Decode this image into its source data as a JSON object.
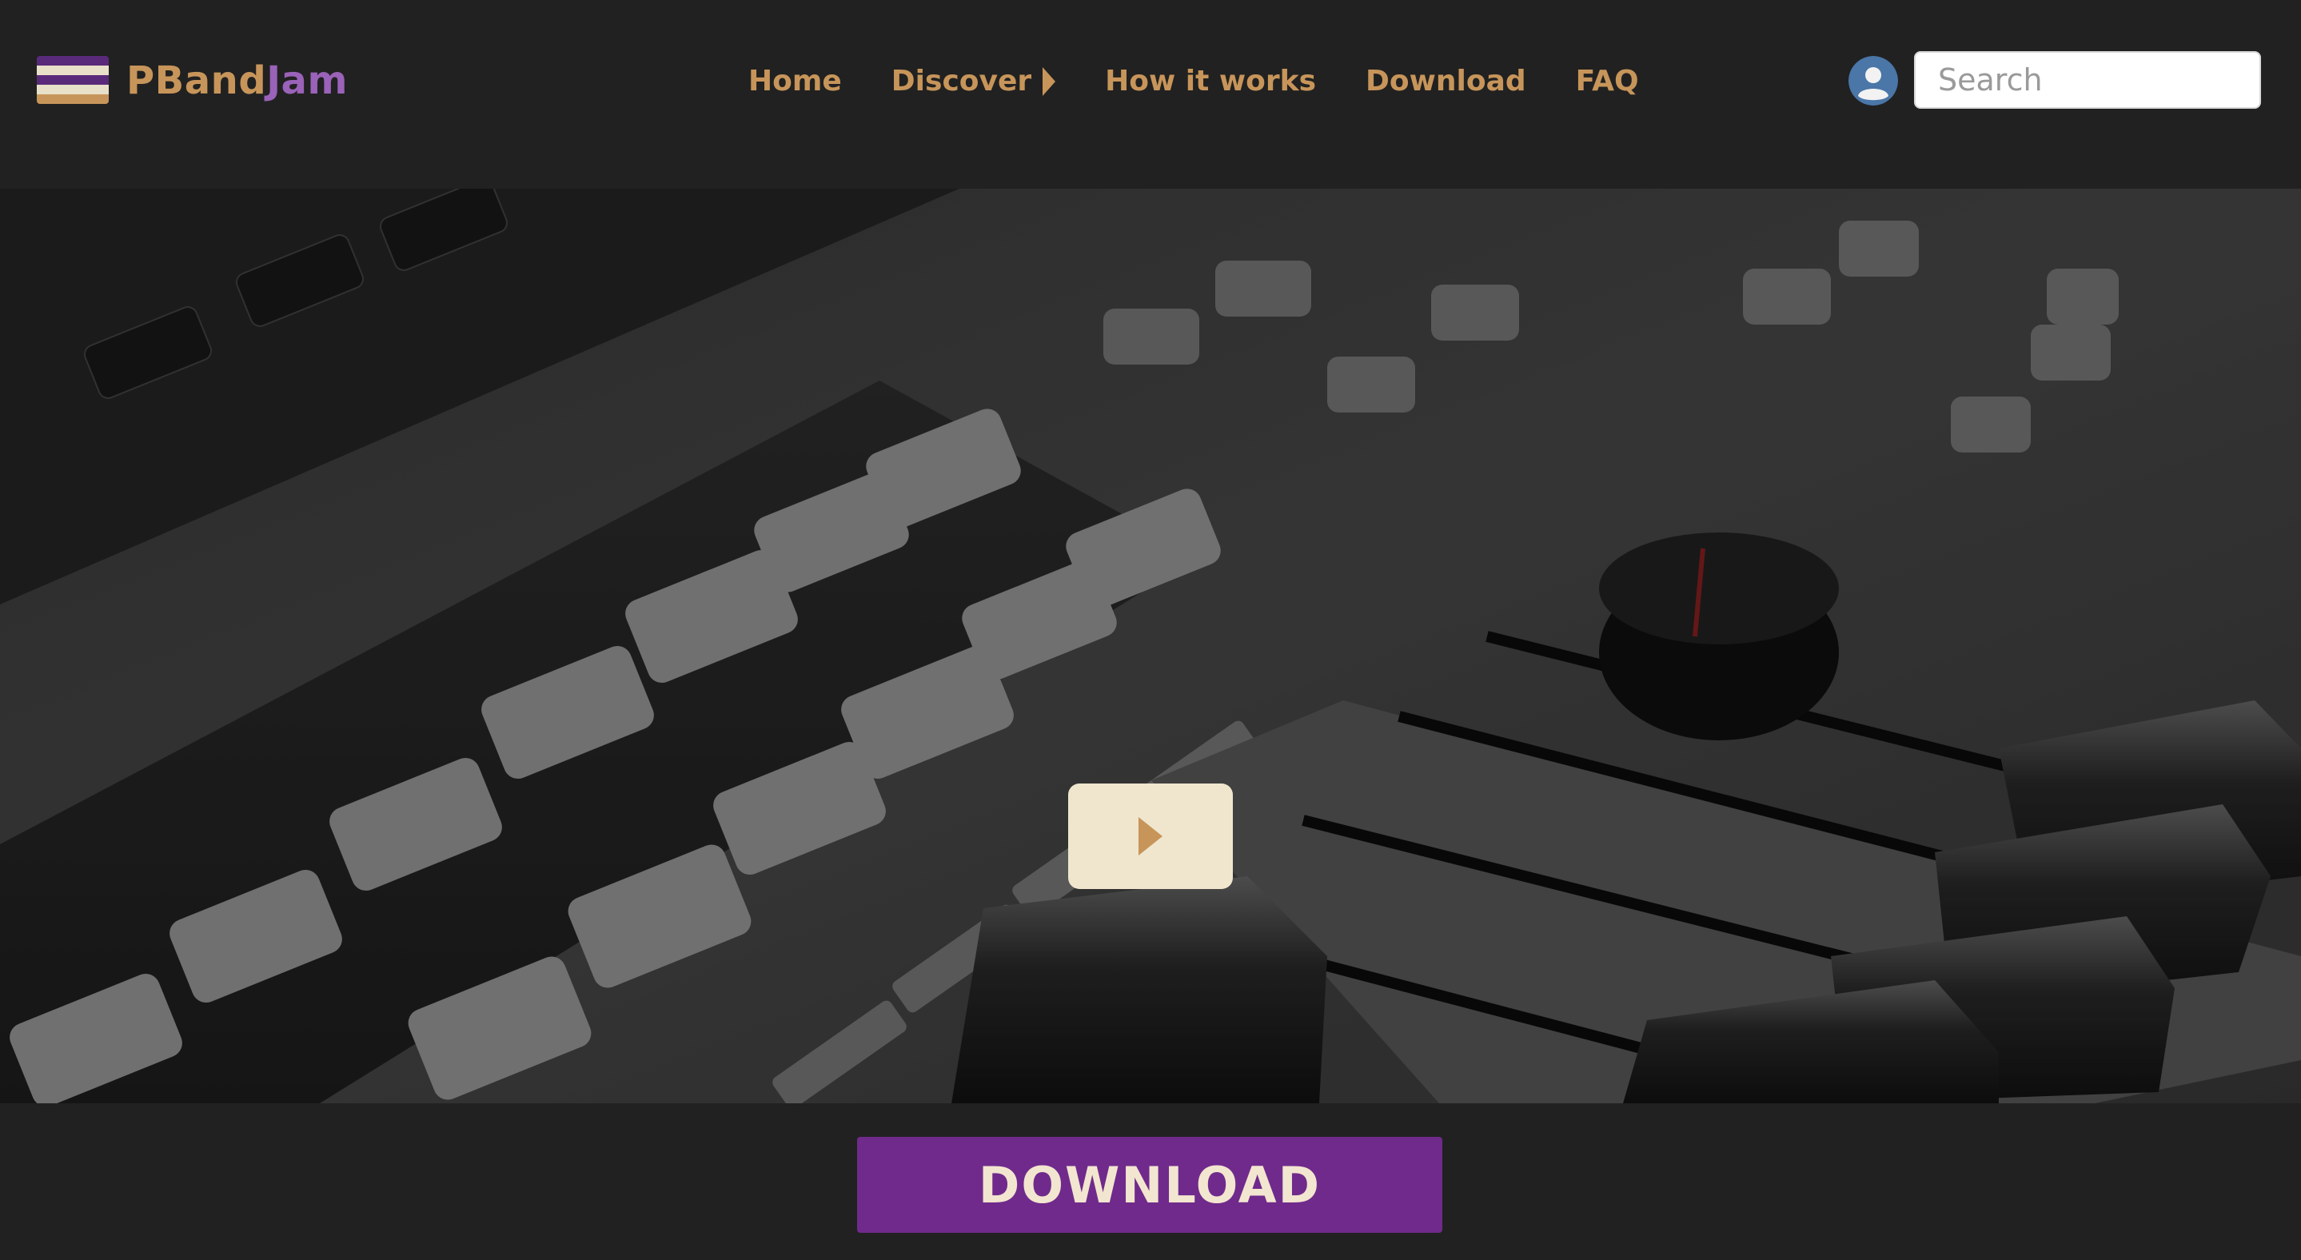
{
  "brand": {
    "name_part1": "PBand",
    "name_part2": "Jam",
    "logo_icon": "stacked-stripes-logo",
    "colors": {
      "gold": "#c7955a",
      "purple": "#9a62b8",
      "stripe_top": "#e8e0c8",
      "stripe_mid": "#5a2a7a",
      "stripe_bottom": "#c7955a"
    }
  },
  "nav": {
    "items": [
      {
        "label": "Home"
      },
      {
        "label": "Discover",
        "icon": "caret-right-icon"
      },
      {
        "label": "How it works"
      },
      {
        "label": "Download"
      },
      {
        "label": "FAQ"
      }
    ],
    "color": "#c7955a"
  },
  "user": {
    "avatar_icon": "user-avatar-icon",
    "avatar_color": "#4a76a8"
  },
  "search": {
    "placeholder": "Search"
  },
  "hero": {
    "media": "music-mixer-controller-video",
    "play_icon": "play-icon",
    "play_button_bg": "#efe6cd",
    "play_icon_color": "#c7955a"
  },
  "download_button": {
    "label": "DOWNLOAD",
    "bg": "#702a8c",
    "text_color": "#f2e6d0"
  }
}
